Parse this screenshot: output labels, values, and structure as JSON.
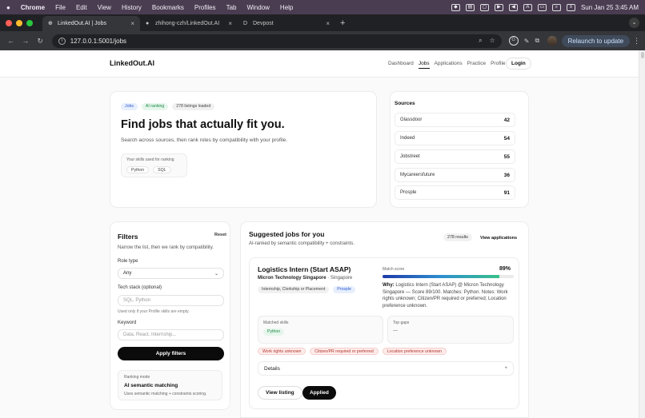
{
  "macos": {
    "apple": "",
    "menus": [
      "Chrome",
      "File",
      "Edit",
      "View",
      "History",
      "Bookmarks",
      "Profiles",
      "Tab",
      "Window",
      "Help"
    ],
    "datetime": "Sun Jan 25  3:45 AM"
  },
  "browser": {
    "tabs": [
      {
        "title": "LinkedOut.AI | Jobs",
        "icon": "globe-icon",
        "active": true
      },
      {
        "title": "zhihong-czh/LinkedOut.AI",
        "icon": "github-icon",
        "active": false
      },
      {
        "title": "Devpost",
        "icon": "devpost-icon",
        "active": false
      }
    ],
    "url": "127.0.0.1:5001/jobs",
    "relaunch_label": "Relaunch to update"
  },
  "header": {
    "brand": "LinkedOut.AI",
    "nav": [
      {
        "label": "Dashboard",
        "active": false
      },
      {
        "label": "Jobs",
        "active": true
      },
      {
        "label": "Applications",
        "active": false
      },
      {
        "label": "Practice",
        "active": false
      },
      {
        "label": "Profile",
        "active": false
      }
    ],
    "login_label": "Login"
  },
  "hero": {
    "pills": [
      "Jobs",
      "AI ranking",
      "278 listings loaded"
    ],
    "title": "Find jobs that actually fit you.",
    "subtitle": "Search across sources, then rank roles by compatibility with your profile.",
    "skills_label": "Your skills used for ranking",
    "skills": [
      "Python",
      "SQL"
    ]
  },
  "sources": {
    "title": "Sources",
    "items": [
      {
        "name": "Glassdoor",
        "count": "42"
      },
      {
        "name": "Indeed",
        "count": "54"
      },
      {
        "name": "Jobstreet",
        "count": "55"
      },
      {
        "name": "Mycareersfuture",
        "count": "36"
      },
      {
        "name": "Prosple",
        "count": "91"
      }
    ]
  },
  "filters": {
    "title": "Filters",
    "reset_label": "Reset",
    "subtitle": "Narrow the list, then we rank by compatibility.",
    "role_type_label": "Role type",
    "role_type_value": "Any",
    "tech_label": "Tech stack (optional)",
    "tech_placeholder": "SQL, Python",
    "tech_help": "Used only if your Profile skills are empty.",
    "keyword_label": "Keyword",
    "keyword_placeholder": "Data, React, Internship...",
    "apply_label": "Apply filters",
    "ranking_mode_label": "Ranking mode",
    "ranking_mode_value": "AI semantic matching",
    "ranking_mode_desc": "Uses semantic matching + constraints scoring."
  },
  "suggested": {
    "title": "Suggested jobs for you",
    "subtitle": "AI-ranked by semantic compatibility + constraints.",
    "results_label": "278 results",
    "view_applications_label": "View applications"
  },
  "job": {
    "title": "Logistics Intern (Start ASAP)",
    "company": "Micron Technology Singapore",
    "location": "· Singapore",
    "tags": [
      "Internship, Clerkship or Placement",
      "Prosple"
    ],
    "match_label": "Match score",
    "match_value": "89%",
    "match_fraction": 0.89,
    "why_label": "Why:",
    "why_text": " Logistics Intern (Start ASAP) @ Micron Technology Singapore — Score 89/100. Matches: Python. Notes: Work rights unknown; Citizen/PR required or preferred; Location preference unknown.",
    "matched_label": "Matched skills",
    "matched_skills": [
      "Python"
    ],
    "gaps_label": "Top gaps",
    "gaps_value": "—",
    "warnings": [
      "Work rights unknown",
      "Citizen/PR required or preferred",
      "Location preference unknown"
    ],
    "details_label": "Details",
    "details_toggle": "+",
    "view_listing_label": "View listing",
    "applied_label": "Applied"
  },
  "colors": {
    "accent_blue": "#2f5bd0",
    "accent_green": "#1c8a45",
    "warn_red": "#b3362c",
    "button_black": "#0b0b0b"
  }
}
